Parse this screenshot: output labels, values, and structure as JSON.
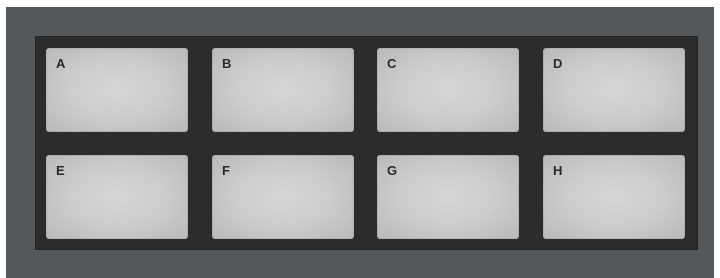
{
  "pads": [
    {
      "label": "A"
    },
    {
      "label": "B"
    },
    {
      "label": "C"
    },
    {
      "label": "D"
    },
    {
      "label": "E"
    },
    {
      "label": "F"
    },
    {
      "label": "G"
    },
    {
      "label": "H"
    }
  ],
  "colors": {
    "device_body": "#55585b",
    "pad_panel": "#2c2c2c",
    "pad_surface": "#cdcdcd",
    "pad_label": "#2a2a2a"
  }
}
